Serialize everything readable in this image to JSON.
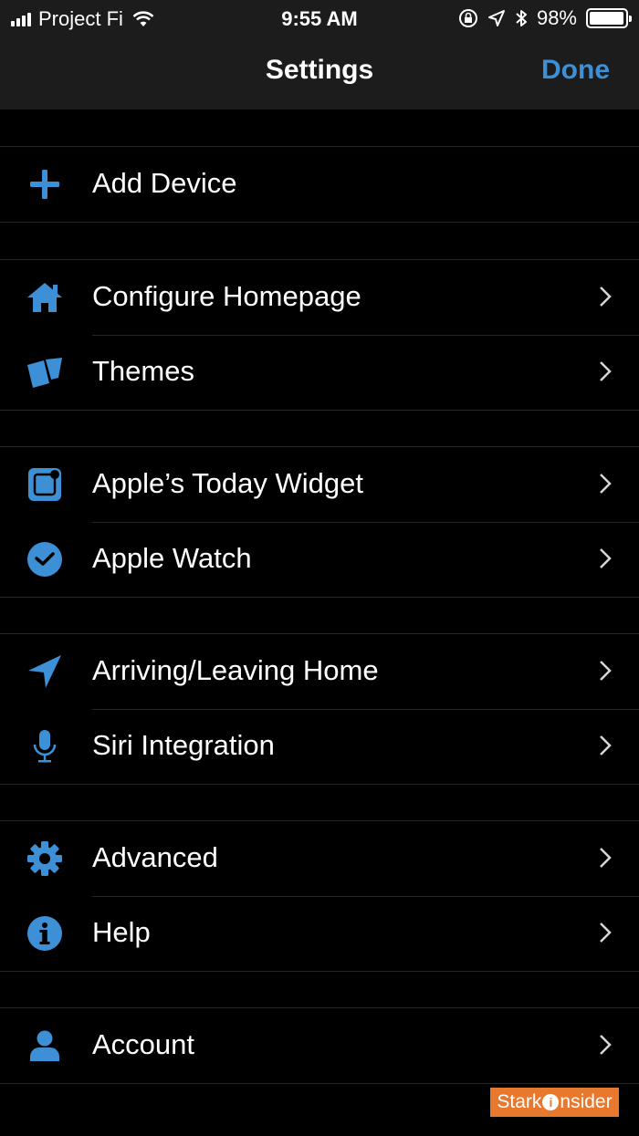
{
  "status_bar": {
    "carrier": "Project Fi",
    "time": "9:55 AM",
    "battery_text": "98%",
    "battery_level": 0.98
  },
  "nav": {
    "title": "Settings",
    "done_label": "Done"
  },
  "accent_color": "#3d8fd6",
  "groups": [
    {
      "items": [
        {
          "label": "Add Device",
          "icon": "plus-icon",
          "chevron": false
        }
      ]
    },
    {
      "items": [
        {
          "label": "Configure Homepage",
          "icon": "home-icon",
          "chevron": true
        },
        {
          "label": "Themes",
          "icon": "themes-cards-icon",
          "chevron": true
        }
      ]
    },
    {
      "items": [
        {
          "label": "Apple’s Today Widget",
          "icon": "widget-icon",
          "chevron": true
        },
        {
          "label": "Apple Watch",
          "icon": "clock-icon",
          "chevron": true
        }
      ]
    },
    {
      "items": [
        {
          "label": "Arriving/Leaving Home",
          "icon": "location-arrow-icon",
          "chevron": true
        },
        {
          "label": "Siri Integration",
          "icon": "microphone-icon",
          "chevron": true
        }
      ]
    },
    {
      "items": [
        {
          "label": "Advanced",
          "icon": "gear-icon",
          "chevron": true
        },
        {
          "label": "Help",
          "icon": "info-icon",
          "chevron": true
        }
      ]
    },
    {
      "items": [
        {
          "label": "Account",
          "icon": "user-icon",
          "chevron": true
        }
      ]
    }
  ],
  "watermark": {
    "part1": "Stark",
    "part2": "nsider"
  }
}
